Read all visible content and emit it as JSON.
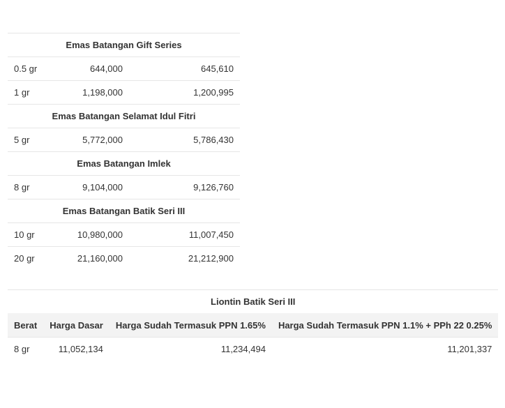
{
  "gold_bar_table": {
    "sections": [
      {
        "title": "Emas Batangan Gift Series",
        "rows": [
          {
            "weight": "0.5 gr",
            "base": "644,000",
            "total": "645,610"
          },
          {
            "weight": "1 gr",
            "base": "1,198,000",
            "total": "1,200,995"
          }
        ]
      },
      {
        "title": "Emas Batangan Selamat Idul Fitri",
        "rows": [
          {
            "weight": "5 gr",
            "base": "5,772,000",
            "total": "5,786,430"
          }
        ]
      },
      {
        "title": "Emas Batangan Imlek",
        "rows": [
          {
            "weight": "8 gr",
            "base": "9,104,000",
            "total": "9,126,760"
          }
        ]
      },
      {
        "title": "Emas Batangan Batik Seri III",
        "rows": [
          {
            "weight": "10 gr",
            "base": "10,980,000",
            "total": "11,007,450"
          },
          {
            "weight": "20 gr",
            "base": "21,160,000",
            "total": "21,212,900"
          }
        ]
      }
    ]
  },
  "pendant_table": {
    "title": "Liontin Batik Seri III",
    "headers": {
      "weight": "Berat",
      "base": "Harga Dasar",
      "ppn": "Harga Sudah Termasuk PPN 1.65%",
      "ppn_pph": "Harga Sudah Termasuk PPN 1.1% + PPh 22 0.25%"
    },
    "rows": [
      {
        "weight": "8 gr",
        "base": "11,052,134",
        "ppn": "11,234,494",
        "ppn_pph": "11,201,337"
      }
    ]
  }
}
